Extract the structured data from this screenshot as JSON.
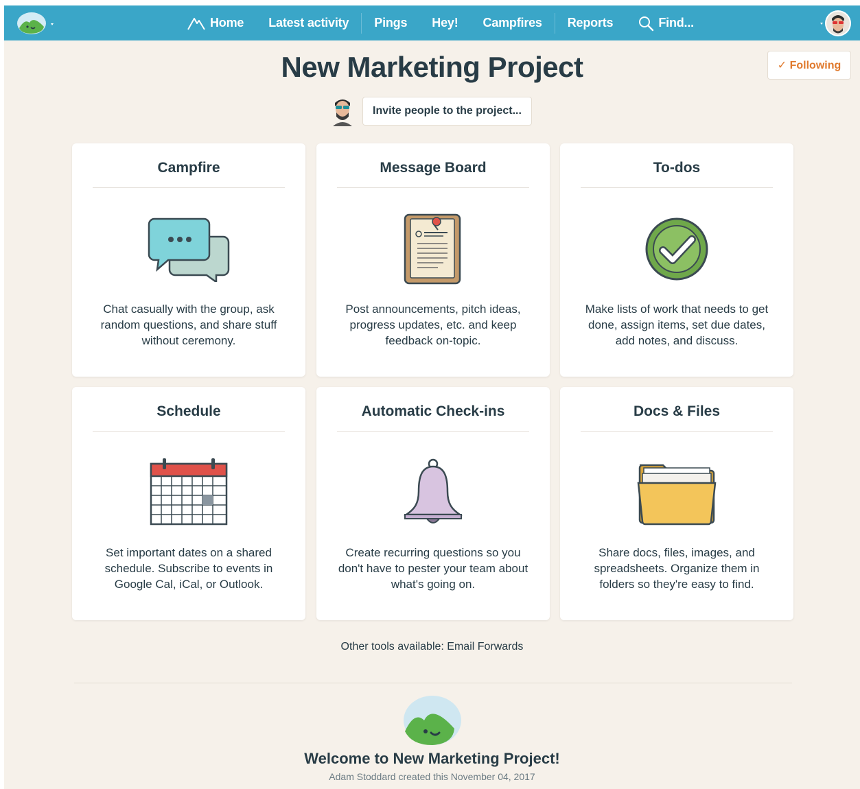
{
  "nav": {
    "items": [
      {
        "label": "Home",
        "icon": "home-mountain-icon"
      },
      {
        "label": "Latest activity"
      },
      {
        "label": "Pings"
      },
      {
        "label": "Hey!"
      },
      {
        "label": "Campfires"
      },
      {
        "label": "Reports"
      },
      {
        "label": "Find...",
        "icon": "search-icon"
      }
    ],
    "colors": {
      "bar": "#3aa6c8",
      "text": "#ffffff"
    }
  },
  "project": {
    "title": "New Marketing Project",
    "following_label": "✓ Following",
    "invite_label": "Invite people to the project..."
  },
  "tools": [
    {
      "title": "Campfire",
      "icon": "chat-bubbles-icon",
      "description": "Chat casually with the group, ask random questions, and share stuff without ceremony."
    },
    {
      "title": "Message Board",
      "icon": "pinned-note-icon",
      "description": "Post announcements, pitch ideas, progress updates, etc. and keep feedback on-topic."
    },
    {
      "title": "To-dos",
      "icon": "checkmark-circle-icon",
      "description": "Make lists of work that needs to get done, assign items, set due dates, add notes, and discuss."
    },
    {
      "title": "Schedule",
      "icon": "calendar-icon",
      "description": "Set important dates on a shared schedule. Subscribe to events in Google Cal, iCal, or Outlook."
    },
    {
      "title": "Automatic Check-ins",
      "icon": "bell-icon",
      "description": "Create recurring questions so you don't have to pester your team about what's going on."
    },
    {
      "title": "Docs & Files",
      "icon": "folder-icon",
      "description": "Share docs, files, images, and spreadsheets. Organize them in folders so they're easy to find."
    }
  ],
  "other_tools": "Other tools available: Email Forwards",
  "welcome": {
    "title": "Welcome to New Marketing Project!",
    "created": "Adam Stoddard created this November 04, 2017"
  },
  "accent_colors": {
    "following": "#e07a2e",
    "background": "#f6f1ea"
  }
}
